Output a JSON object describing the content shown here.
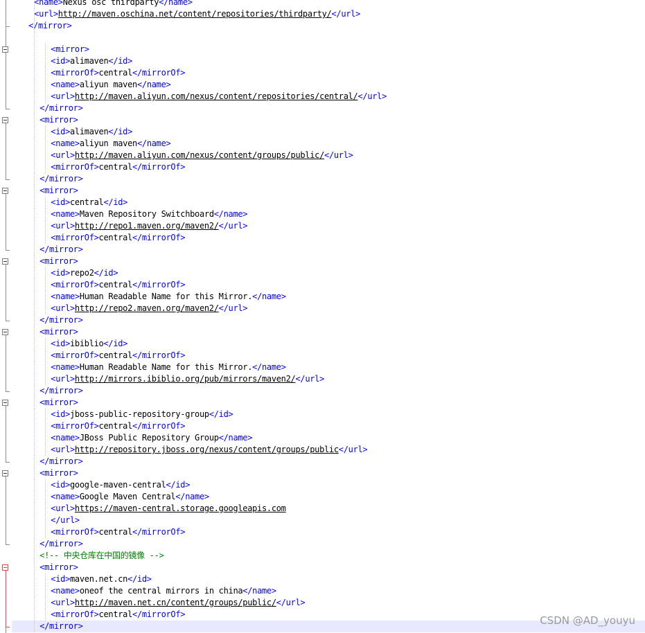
{
  "editor": {
    "lines": [
      {
        "indent": 3,
        "open": "<name>",
        "text": "Nexus osc thirdparty",
        "close": "</name>"
      },
      {
        "indent": 3,
        "open": "<url>",
        "link": "http://maven.oschina.net/content/repositories/thirdparty/",
        "close": "</url>"
      },
      {
        "indent": 2,
        "open": "</mirror>"
      },
      {
        "indent": 2
      },
      {
        "indent": 6,
        "open": "<mirror>"
      },
      {
        "indent": 6,
        "open": "<id>",
        "text": "alimaven",
        "close": "</id>"
      },
      {
        "indent": 6,
        "open": "<mirrorOf>",
        "text": "central",
        "close": "</mirrorOf>"
      },
      {
        "indent": 6,
        "open": "<name>",
        "text": "aliyun maven",
        "close": "</name>"
      },
      {
        "indent": 6,
        "open": "<url>",
        "link": "http://maven.aliyun.com/nexus/content/repositories/central/",
        "close": "</url>"
      },
      {
        "indent": 4,
        "open": "</mirror>"
      },
      {
        "indent": 4,
        "open": "<mirror>"
      },
      {
        "indent": 6,
        "open": "<id>",
        "text": "alimaven",
        "close": "</id>"
      },
      {
        "indent": 6,
        "open": "<name>",
        "text": "aliyun maven",
        "close": "</name>"
      },
      {
        "indent": 6,
        "open": "<url>",
        "link": "http://maven.aliyun.com/nexus/content/groups/public/",
        "close": "</url>"
      },
      {
        "indent": 6,
        "open": "<mirrorOf>",
        "text": "central",
        "close": "</mirrorOf>"
      },
      {
        "indent": 4,
        "open": "</mirror>"
      },
      {
        "indent": 4,
        "open": "<mirror>"
      },
      {
        "indent": 6,
        "open": "<id>",
        "text": "central",
        "close": "</id>"
      },
      {
        "indent": 6,
        "open": "<name>",
        "text": "Maven Repository Switchboard",
        "close": "</name>"
      },
      {
        "indent": 6,
        "open": "<url>",
        "link": "http://repo1.maven.org/maven2/",
        "close": "</url>"
      },
      {
        "indent": 6,
        "open": "<mirrorOf>",
        "text": "central",
        "close": "</mirrorOf>"
      },
      {
        "indent": 4,
        "open": "</mirror>"
      },
      {
        "indent": 4,
        "open": "<mirror>"
      },
      {
        "indent": 6,
        "open": "<id>",
        "text": "repo2",
        "close": "</id>"
      },
      {
        "indent": 6,
        "open": "<mirrorOf>",
        "text": "central",
        "close": "</mirrorOf>"
      },
      {
        "indent": 6,
        "open": "<name>",
        "text": "Human Readable Name for this Mirror.",
        "close": "</name>"
      },
      {
        "indent": 6,
        "open": "<url>",
        "link": "http://repo2.maven.org/maven2/",
        "close": "</url>"
      },
      {
        "indent": 4,
        "open": "</mirror>"
      },
      {
        "indent": 4,
        "open": "<mirror>"
      },
      {
        "indent": 6,
        "open": "<id>",
        "text": "ibiblio",
        "close": "</id>"
      },
      {
        "indent": 6,
        "open": "<mirrorOf>",
        "text": "central",
        "close": "</mirrorOf>"
      },
      {
        "indent": 6,
        "open": "<name>",
        "text": "Human Readable Name for this Mirror.",
        "close": "</name>"
      },
      {
        "indent": 6,
        "open": "<url>",
        "link": "http://mirrors.ibiblio.org/pub/mirrors/maven2/",
        "close": "</url>"
      },
      {
        "indent": 4,
        "open": "</mirror>"
      },
      {
        "indent": 4,
        "open": "<mirror>"
      },
      {
        "indent": 6,
        "open": "<id>",
        "text": "jboss-public-repository-group",
        "close": "</id>"
      },
      {
        "indent": 6,
        "open": "<mirrorOf>",
        "text": "central",
        "close": "</mirrorOf>"
      },
      {
        "indent": 6,
        "open": "<name>",
        "text": "JBoss Public Repository Group",
        "close": "</name>"
      },
      {
        "indent": 6,
        "open": "<url>",
        "link": "http://repository.jboss.org/nexus/content/groups/public",
        "close": "</url>"
      },
      {
        "indent": 4,
        "open": "</mirror>"
      },
      {
        "indent": 4,
        "open": "<mirror>"
      },
      {
        "indent": 6,
        "open": "<id>",
        "text": "google-maven-central",
        "close": "</id>"
      },
      {
        "indent": 6,
        "open": "<name>",
        "text": "Google Maven Central",
        "close": "</name>"
      },
      {
        "indent": 6,
        "open": "<url>",
        "link": "https://maven-central.storage.googleapis.com"
      },
      {
        "indent": 6,
        "open": "</url>"
      },
      {
        "indent": 6,
        "open": "<mirrorOf>",
        "text": "central",
        "close": "</mirrorOf>"
      },
      {
        "indent": 4,
        "open": "</mirror>"
      },
      {
        "indent": 4,
        "comment": "<!-- 中央仓库在中国的镜像 -->"
      },
      {
        "indent": 4,
        "open": "<mirror>"
      },
      {
        "indent": 6,
        "open": "<id>",
        "text": "maven.net.cn",
        "close": "</id>"
      },
      {
        "indent": 6,
        "open": "<name>",
        "text": "oneof the central mirrors in china",
        "close": "</name>"
      },
      {
        "indent": 6,
        "open": "<url>",
        "link": "http://maven.net.cn/content/groups/public/",
        "close": "</url>"
      },
      {
        "indent": 6,
        "open": "<mirrorOf>",
        "text": "central",
        "close": "</mirrorOf>"
      },
      {
        "indent": 4,
        "open": "</mirror>",
        "current": true
      }
    ]
  },
  "colors": {
    "tag": "#0000ff",
    "text": "#000000",
    "comment": "#008000",
    "current_line": "#e8e8ff",
    "fold_marker": "#7a7a7a",
    "fold_marker_active": "#e0404a"
  },
  "watermark": {
    "text": "CSDN @AD_youyu"
  }
}
